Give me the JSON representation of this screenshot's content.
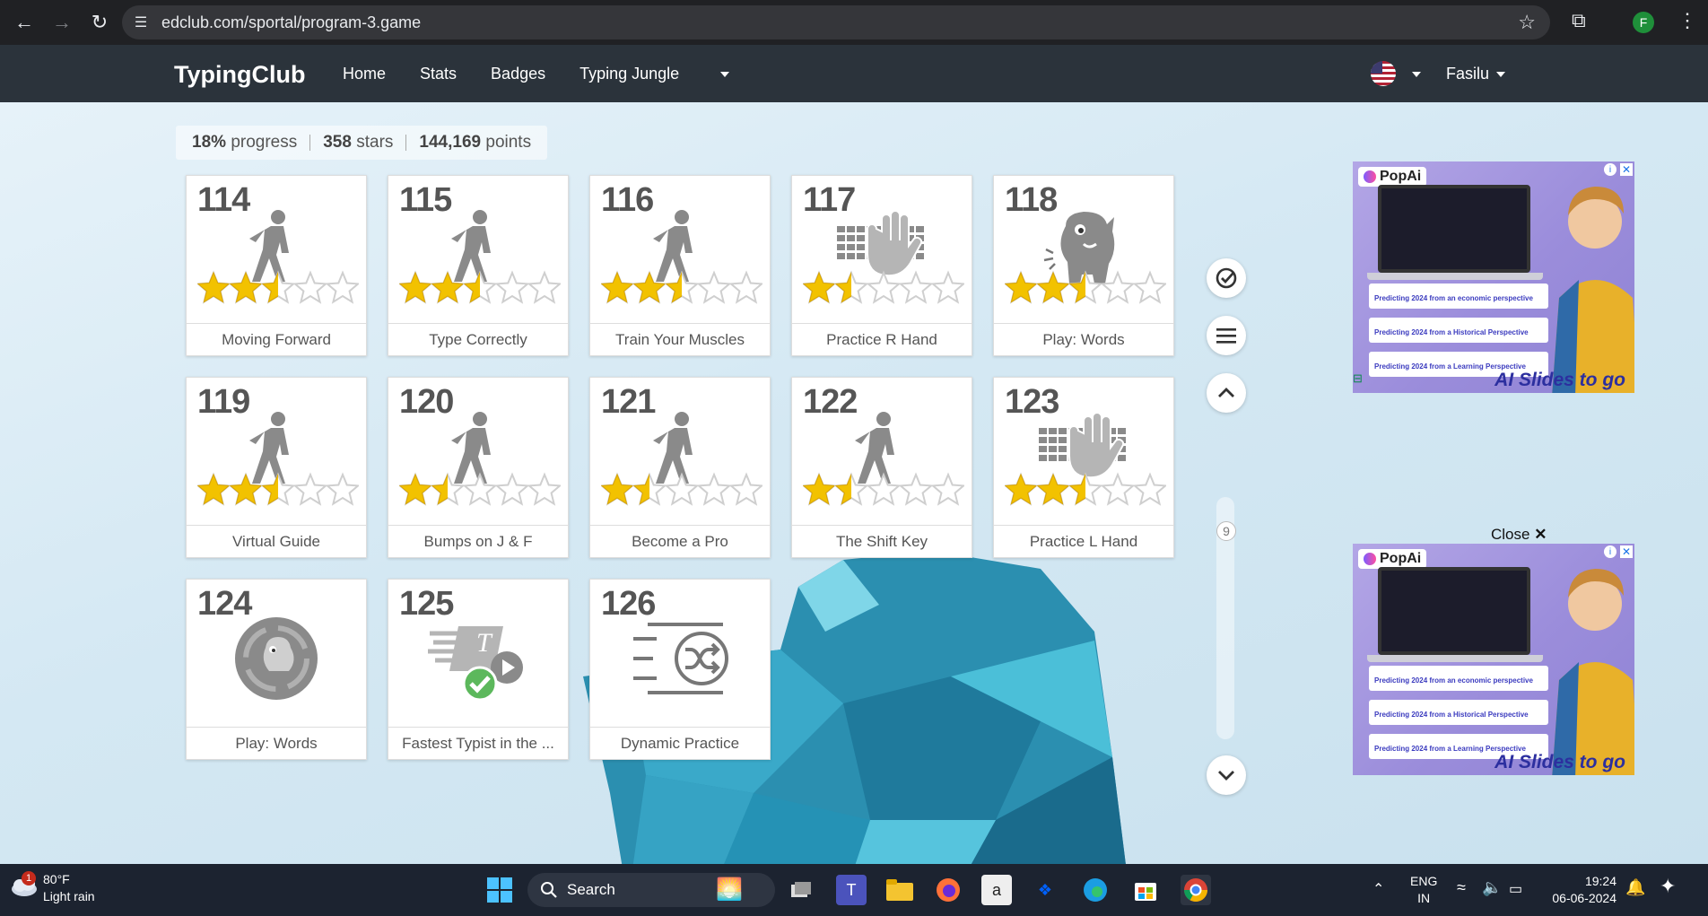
{
  "browser": {
    "url": "edclub.com/sportal/program-3.game",
    "profile_initial": "F"
  },
  "header": {
    "brand": "TypingClub",
    "nav": [
      "Home",
      "Stats",
      "Badges",
      "Typing Jungle"
    ],
    "user": "Fasilu"
  },
  "stats": {
    "progress_value": "18%",
    "progress_label": "progress",
    "stars_value": "358",
    "stars_label": "stars",
    "points_value": "144,169",
    "points_label": "points"
  },
  "lessons": [
    {
      "num": "114",
      "title": "Moving Forward",
      "icon": "walking-person-icon",
      "stars": 2.5
    },
    {
      "num": "115",
      "title": "Type Correctly",
      "icon": "walking-person-icon",
      "stars": 2.5
    },
    {
      "num": "116",
      "title": "Train Your Muscles",
      "icon": "walking-person-icon",
      "stars": 2.5
    },
    {
      "num": "117",
      "title": "Practice R Hand",
      "icon": "keyboard-hand-icon",
      "stars": 1.5
    },
    {
      "num": "118",
      "title": "Play: Words",
      "icon": "game-creature-icon",
      "stars": 2.5
    },
    {
      "num": "119",
      "title": "Virtual Guide",
      "icon": "walking-person-icon",
      "stars": 2.5
    },
    {
      "num": "120",
      "title": "Bumps on J & F",
      "icon": "walking-person-icon",
      "stars": 1.5
    },
    {
      "num": "121",
      "title": "Become a Pro",
      "icon": "walking-person-icon",
      "stars": 1.5
    },
    {
      "num": "122",
      "title": "The Shift Key",
      "icon": "walking-person-icon",
      "stars": 1.5
    },
    {
      "num": "123",
      "title": "Practice L Hand",
      "icon": "keyboard-hand-icon",
      "stars": 2.5
    },
    {
      "num": "124",
      "title": "Play: Words",
      "icon": "game-disc-icon",
      "stars": null
    },
    {
      "num": "125",
      "title": "Fastest Typist in the ...",
      "icon": "video-check-icon",
      "stars": null
    },
    {
      "num": "126",
      "title": "Dynamic Practice",
      "icon": "shuffle-lines-icon",
      "stars": null
    }
  ],
  "side_controls": {
    "page_number": "9"
  },
  "ads": {
    "brand": "PopAi",
    "rows": [
      "Predicting 2024 from an economic perspective",
      "Predicting 2024 from a Historical Perspective",
      "Predicting 2024 from a Learning Perspective"
    ],
    "tagline": "AI Slides to go",
    "close_label": "Close"
  },
  "taskbar": {
    "weather_temp": "80°F",
    "weather_desc": "Light rain",
    "weather_badge": "1",
    "search_label": "Search",
    "lang_top": "ENG",
    "lang_bottom": "IN",
    "time": "19:24",
    "date": "06-06-2024"
  },
  "colors": {
    "header_bg": "#2b333b",
    "star_gold": "#f2c200",
    "check_green": "#5cb85c"
  }
}
